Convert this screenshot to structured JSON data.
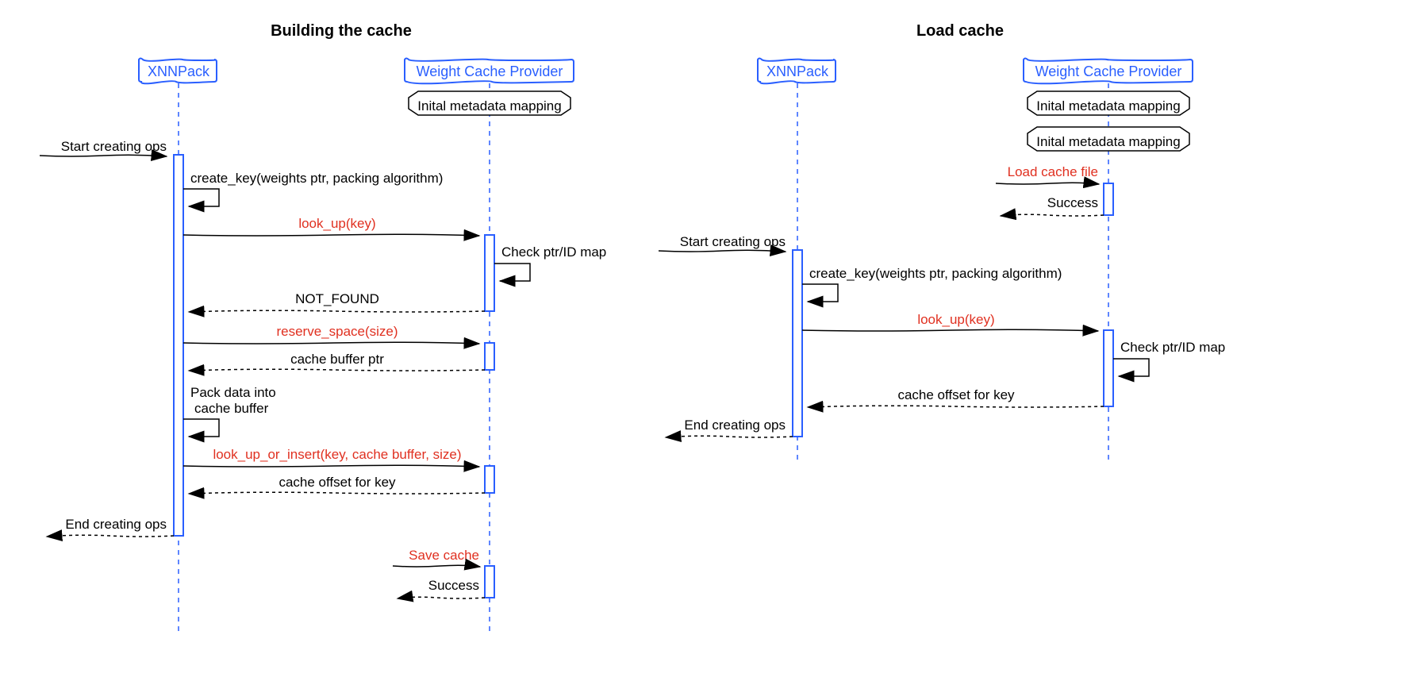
{
  "left": {
    "title": "Building the cache",
    "participants": {
      "a": "XNNPack",
      "b": "Weight Cache Provider"
    },
    "note1": "Inital metadata mapping",
    "msgs": {
      "start": "Start creating ops",
      "create_key": "create_key(weights ptr, packing algorithm)",
      "look_up": "look_up(key)",
      "check_map": "Check ptr/ID map",
      "not_found": "NOT_FOUND",
      "reserve": "reserve_space(size)",
      "buf_ptr": "cache buffer ptr",
      "pack1": "Pack data into",
      "pack2": "cache buffer",
      "insert": "look_up_or_insert(key, cache buffer, size)",
      "offset": "cache offset for key",
      "end": "End creating ops",
      "save": "Save cache",
      "success": "Success"
    }
  },
  "right": {
    "title": "Load cache",
    "participants": {
      "a": "XNNPack",
      "b": "Weight Cache Provider"
    },
    "note1": "Inital metadata mapping",
    "note2": "Inital metadata mapping",
    "msgs": {
      "load": "Load cache file",
      "success": "Success",
      "start": "Start creating ops",
      "create_key": "create_key(weights ptr, packing algorithm)",
      "look_up": "look_up(key)",
      "check_map": "Check ptr/ID map",
      "offset": "cache offset for key",
      "end": "End creating ops"
    }
  }
}
